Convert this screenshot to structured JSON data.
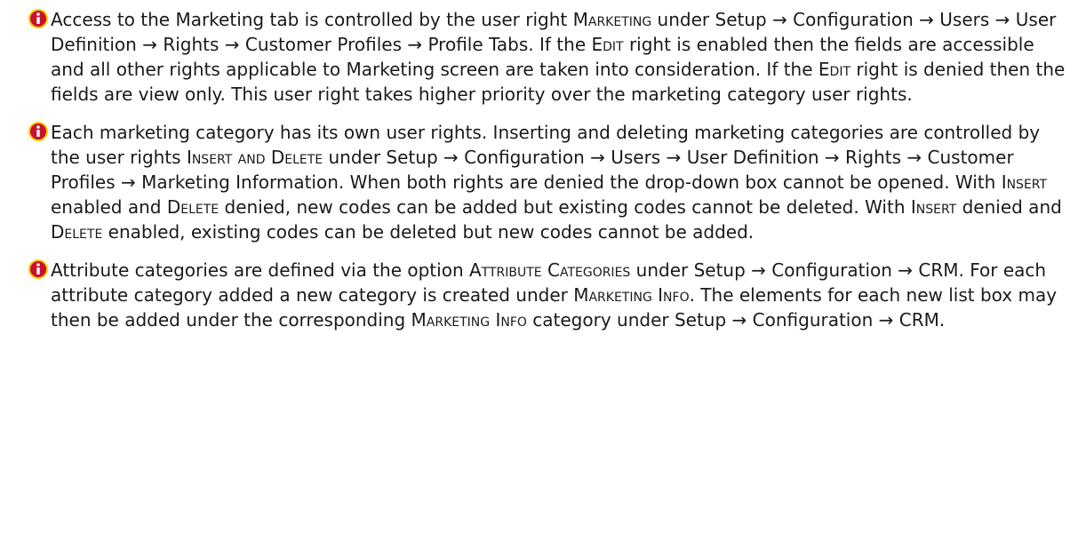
{
  "notes": [
    {
      "icon": "info-icon",
      "segments": [
        {
          "t": "Access to the Marketing tab is controlled by the user right ",
          "sc": false
        },
        {
          "t": "Marketing",
          "sc": true
        },
        {
          "t": " under Setup → Configuration → Users → User Definition → Rights → Customer Profiles → Profile Tabs. If the ",
          "sc": false
        },
        {
          "t": "Edit",
          "sc": true
        },
        {
          "t": " right is enabled then the fields are accessible and all other rights applicable to Marketing screen are taken into consideration. If the ",
          "sc": false
        },
        {
          "t": "Edit",
          "sc": true
        },
        {
          "t": " right is denied then the fields are view only. This user right takes higher priority over the marketing category user rights.",
          "sc": false
        }
      ]
    },
    {
      "icon": "info-icon",
      "segments": [
        {
          "t": "Each marketing category has its own user rights. Inserting and deleting marketing categories are controlled by the user rights ",
          "sc": false
        },
        {
          "t": "Insert and Delete",
          "sc": true
        },
        {
          "t": " under Setup → Configuration → Users → User Definition → Rights → Customer Profiles → Marketing Information. When both rights are denied the drop-down box cannot be opened. With ",
          "sc": false
        },
        {
          "t": "Insert",
          "sc": true
        },
        {
          "t": " enabled and ",
          "sc": false
        },
        {
          "t": "Delete",
          "sc": true
        },
        {
          "t": " denied, new codes can be added but existing codes cannot be deleted. With ",
          "sc": false
        },
        {
          "t": "Insert",
          "sc": true
        },
        {
          "t": " denied and ",
          "sc": false
        },
        {
          "t": "Delete",
          "sc": true
        },
        {
          "t": " enabled, existing codes can be deleted but new codes cannot be added.",
          "sc": false
        }
      ]
    },
    {
      "icon": "info-icon",
      "segments": [
        {
          "t": "Attribute categories are defined via the option ",
          "sc": false
        },
        {
          "t": "Attribute Categories",
          "sc": true
        },
        {
          "t": " under Setup → Configuration → CRM. For each attribute category added a new category is created under ",
          "sc": false
        },
        {
          "t": "Marketing Info",
          "sc": true
        },
        {
          "t": ". The elements for each new list box may then be added under the corresponding ",
          "sc": false
        },
        {
          "t": "Marketing Info",
          "sc": true
        },
        {
          "t": " category under Setup → Configuration → CRM.",
          "sc": false
        }
      ]
    }
  ],
  "colors": {
    "icon_fill": "#c8102e",
    "icon_ring": "#ffcc00",
    "text": "#1a1a1a"
  }
}
